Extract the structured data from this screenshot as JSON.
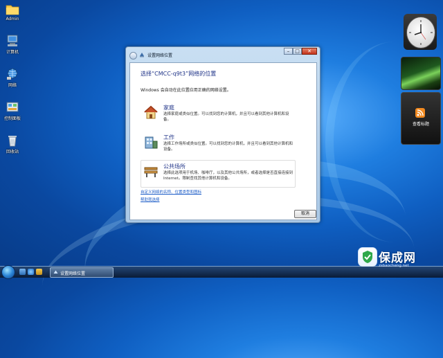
{
  "desktop": {
    "icons": [
      {
        "label": "Admin",
        "icon": "folder-icon"
      },
      {
        "label": "计算机",
        "icon": "computer-icon"
      },
      {
        "label": "网络",
        "icon": "network-icon"
      },
      {
        "label": "控制面板",
        "icon": "control-panel-icon"
      },
      {
        "label": "回收站",
        "icon": "recycle-bin-icon"
      }
    ]
  },
  "gadgets": {
    "clock_icon": "clock-icon",
    "feed_label": "查看标题"
  },
  "dialog": {
    "title": "设置网络位置",
    "heading": "选择“CMCC-q9t3”网络的位置",
    "description": "Windows 会自动在此位置应用正确的网络设置。",
    "options": [
      {
        "name": "家庭",
        "text": "选择家庭或类似位置。可以找到您的计算机，并且可以看到其他计算机和设备。",
        "icon": "home-icon"
      },
      {
        "name": "工作",
        "text": "选择工作场所或类似位置。可以找到您的计算机，并且可以看到其他计算机和设备。",
        "icon": "work-icon"
      },
      {
        "name": "公共场所",
        "text": "选择此选项用于机场、咖啡厅，以及其他公共场所，或者选择是否直接连接到 Internet。限制查找其他计算机和设备。",
        "icon": "bench-icon"
      }
    ],
    "link_customize": "自定义网络的名称、位置类型和图标",
    "link_help": "帮助我选择",
    "cancel_label": "取消",
    "controls": {
      "minimize": "–",
      "maximize": "□",
      "close": "✕"
    }
  },
  "taskbar": {
    "task_label": "设置网络位置"
  },
  "watermark": {
    "text": "保成网",
    "url": "zsbaocheng.net"
  },
  "colors": {
    "accent_heading": "#1e3287",
    "link": "#1a5bc7",
    "close_button": "#c3321a"
  }
}
